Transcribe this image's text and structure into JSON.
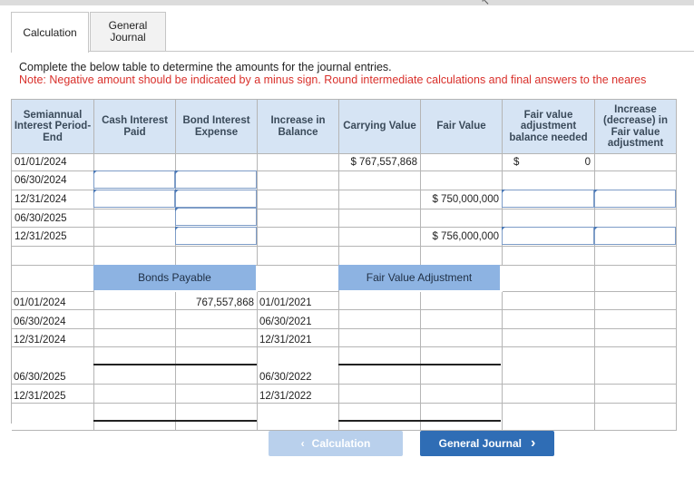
{
  "tabs": [
    {
      "label": "Calculation",
      "active": true
    },
    {
      "label": "General\nJournal",
      "active": false
    }
  ],
  "instructions": {
    "line1": "Complete the below table to determine the amounts for the journal entries.",
    "note": "Note: Negative amount should be indicated by a minus sign. Round intermediate calculations and final answers to the neares"
  },
  "table": {
    "headers": [
      "Semiannual Interest Period-End",
      "Cash Interest Paid",
      "Bond Interest Expense",
      "Increase in Balance",
      "Carrying Value",
      "Fair Value",
      "Fair value adjustment balance needed",
      "Increase (decrease) in Fair value adjustment"
    ],
    "rows": [
      {
        "date": "01/01/2024",
        "carrying_value": "$ 767,557,868",
        "fair_value": "",
        "fva_currency": "$",
        "fva_value": "0"
      },
      {
        "date": "06/30/2024",
        "carrying_value": "",
        "fair_value": ""
      },
      {
        "date": "12/31/2024",
        "carrying_value": "",
        "fair_value": "$ 750,000,000"
      },
      {
        "date": "06/30/2025",
        "carrying_value": "",
        "fair_value": ""
      },
      {
        "date": "12/31/2025",
        "carrying_value": "",
        "fair_value": "$ 756,000,000"
      }
    ]
  },
  "taccounts": {
    "bonds_payable_title": "Bonds Payable",
    "fva_title": "Fair Value Adjustment",
    "left_dates": [
      "01/01/2024",
      "06/30/2024",
      "12/31/2024",
      "06/30/2025",
      "12/31/2025"
    ],
    "bonds_payable_balance": "767,557,868",
    "right_dates": [
      "01/01/2021",
      "06/30/2021",
      "12/31/2021",
      "06/30/2022",
      "12/31/2022"
    ]
  },
  "nav": {
    "prev_label": "Calculation",
    "next_label": "General Journal",
    "prev_icon": "chevron-left-icon",
    "next_icon": "chevron-right-icon"
  },
  "colors": {
    "header_bg": "#d6e4f4",
    "section_header_bg": "#8db3e2",
    "note_red": "#d9302b",
    "next_button": "#2f6db5",
    "prev_button_disabled": "#b9d0ec"
  }
}
